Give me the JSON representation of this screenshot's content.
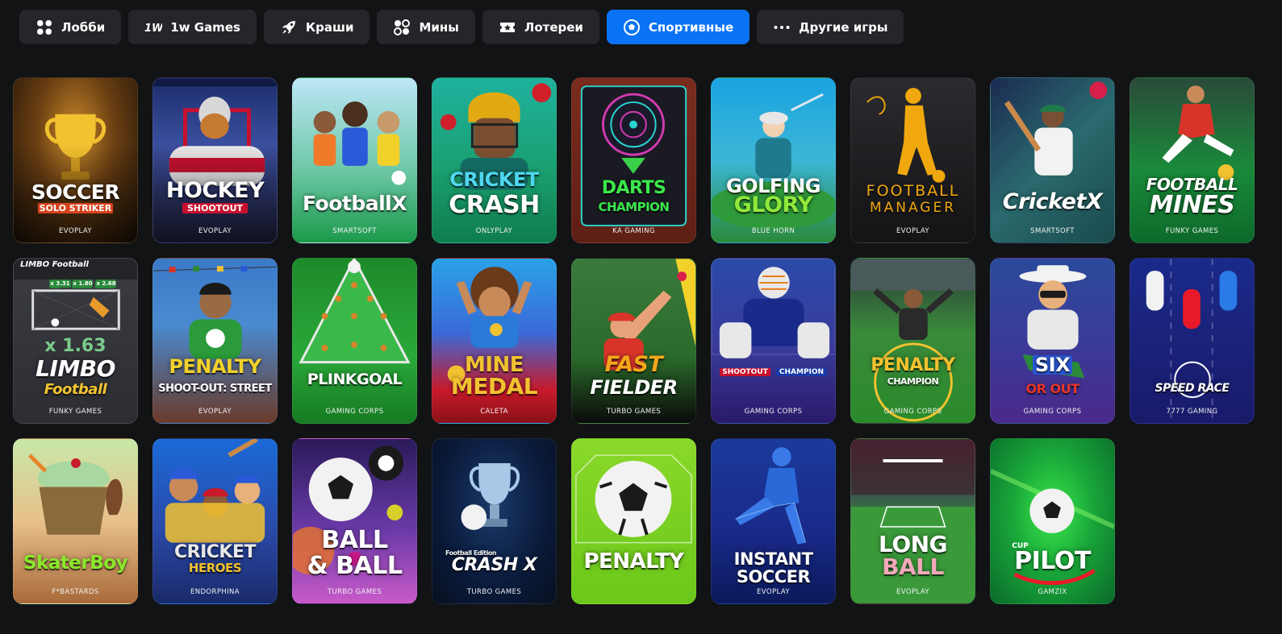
{
  "tabs": [
    {
      "label": "Лобби",
      "icon": "grid-icon",
      "active": false
    },
    {
      "label": "1w Games",
      "icon": "1w-logo-icon",
      "active": false
    },
    {
      "label": "Краши",
      "icon": "rocket-icon",
      "active": false
    },
    {
      "label": "Мины",
      "icon": "mines-icon",
      "active": false
    },
    {
      "label": "Лотереи",
      "icon": "ticket-icon",
      "active": false
    },
    {
      "label": "Спортивные",
      "icon": "soccer-ball-icon",
      "active": true
    },
    {
      "label": "Другие игры",
      "icon": "more-dots-icon",
      "active": false
    }
  ],
  "colors": {
    "accent": "#0a73f5",
    "tab_bg": "#24262a",
    "page_bg": "#121314"
  },
  "games": [
    {
      "title": "SOCCER",
      "subtitle": "SOLO STRIKER",
      "provider": "EVOPLAY"
    },
    {
      "title": "HOCKEY",
      "subtitle": "SHOOTOUT",
      "provider": "EVOPLAY"
    },
    {
      "title": "FootballX",
      "subtitle": "",
      "provider": "SMARTSOFT"
    },
    {
      "title": "CRICKET",
      "subtitle": "CRASH",
      "provider": "ONLYPLAY"
    },
    {
      "title": "DARTS",
      "subtitle": "CHAMPION",
      "provider": "KA GAMING"
    },
    {
      "title": "GOLFING",
      "subtitle": "GLORY",
      "provider": "BLUE HORN"
    },
    {
      "title": "FOOTBALL",
      "subtitle": "MANAGER",
      "provider": "EVOPLAY"
    },
    {
      "title": "CricketX",
      "subtitle": "",
      "provider": "SMARTSOFT"
    },
    {
      "title": "FOOTBALL",
      "subtitle": "MINES",
      "provider": "FUNKY GAMES"
    },
    {
      "title": "LIMBO",
      "subtitle": "Football",
      "provider": "FUNKY GAMES",
      "multiplier": "x 1.63",
      "logo": "LIMBO Football",
      "chips": [
        "x 3.31",
        "x 1.80",
        "x 2.68"
      ]
    },
    {
      "title": "PENALTY",
      "subtitle": "SHOOT-OUT: STREET",
      "provider": "EVOPLAY"
    },
    {
      "title": "PLINKGOAL",
      "subtitle": "",
      "provider": "GAMING CORPS"
    },
    {
      "title": "MINE",
      "subtitle": "MEDAL",
      "provider": "CALETA"
    },
    {
      "title": "FAST",
      "subtitle": "FIELDER",
      "provider": "TURBO GAMES"
    },
    {
      "title": "SHOOTOUT",
      "subtitle": "CHAMPION",
      "provider": "GAMING CORPS"
    },
    {
      "title": "PENALTY",
      "subtitle": "CHAMPION",
      "provider": "GAMING CORPS"
    },
    {
      "title": "SIX",
      "subtitle": "OR OUT",
      "provider": "GAMING CORPS"
    },
    {
      "title": "SPEED RACE",
      "subtitle": "",
      "provider": "7777 GAMING"
    },
    {
      "title": "SkaterBoy",
      "subtitle": "",
      "provider": "F*BASTARDS"
    },
    {
      "title": "CRICKET",
      "subtitle": "HEROES",
      "provider": "ENDORPHINA"
    },
    {
      "title": "BALL",
      "subtitle": "& BALL",
      "provider": "TURBO GAMES"
    },
    {
      "title": "CRASH X",
      "subtitle": "Football Edition",
      "provider": "TURBO GAMES"
    },
    {
      "title": "PENALTY",
      "subtitle": "",
      "provider": ""
    },
    {
      "title": "INSTANT",
      "subtitle": "SOCCER",
      "provider": "EVOPLAY"
    },
    {
      "title": "LONG",
      "subtitle": "BALL",
      "provider": "EVOPLAY"
    },
    {
      "title": "PILOT",
      "subtitle": "CUP",
      "provider": "GAMZIX"
    }
  ]
}
